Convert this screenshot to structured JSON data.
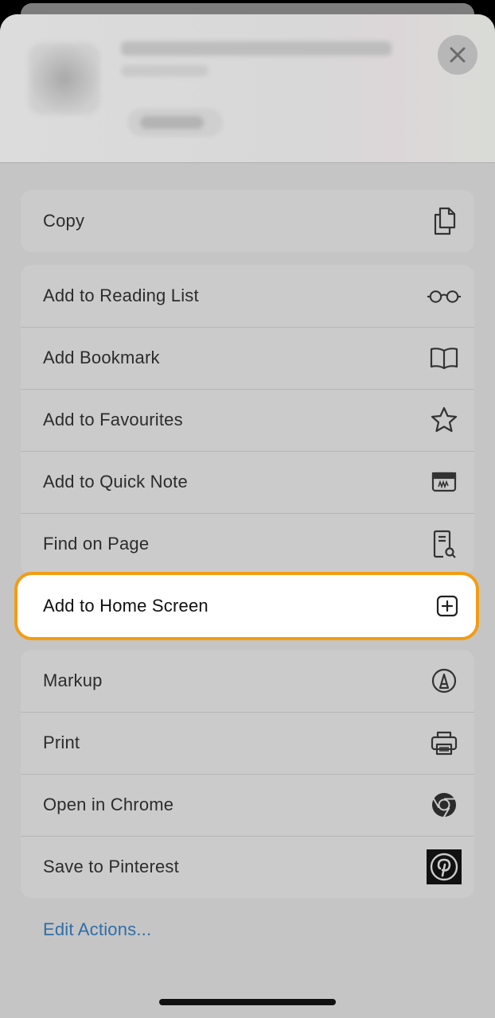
{
  "header": {
    "close_icon": "close-icon"
  },
  "group1": [
    {
      "label": "Copy",
      "icon": "copy-icon"
    }
  ],
  "group2": [
    {
      "label": "Add to Reading List",
      "icon": "glasses-icon"
    },
    {
      "label": "Add Bookmark",
      "icon": "book-icon"
    },
    {
      "label": "Add to Favourites",
      "icon": "star-icon"
    },
    {
      "label": "Add to Quick Note",
      "icon": "quick-note-icon"
    },
    {
      "label": "Find on Page",
      "icon": "find-on-page-icon"
    }
  ],
  "highlighted": {
    "label": "Add to Home Screen",
    "icon": "add-square-icon",
    "accent": "#f39c12"
  },
  "group3": [
    {
      "label": "Markup",
      "icon": "markup-icon"
    },
    {
      "label": "Print",
      "icon": "printer-icon"
    },
    {
      "label": "Open in Chrome",
      "icon": "chrome-icon"
    },
    {
      "label": "Save to Pinterest",
      "icon": "pinterest-icon"
    }
  ],
  "edit_actions": "Edit Actions...",
  "colors": {
    "link": "#2f6ea8",
    "highlight_border": "#f39c12"
  }
}
